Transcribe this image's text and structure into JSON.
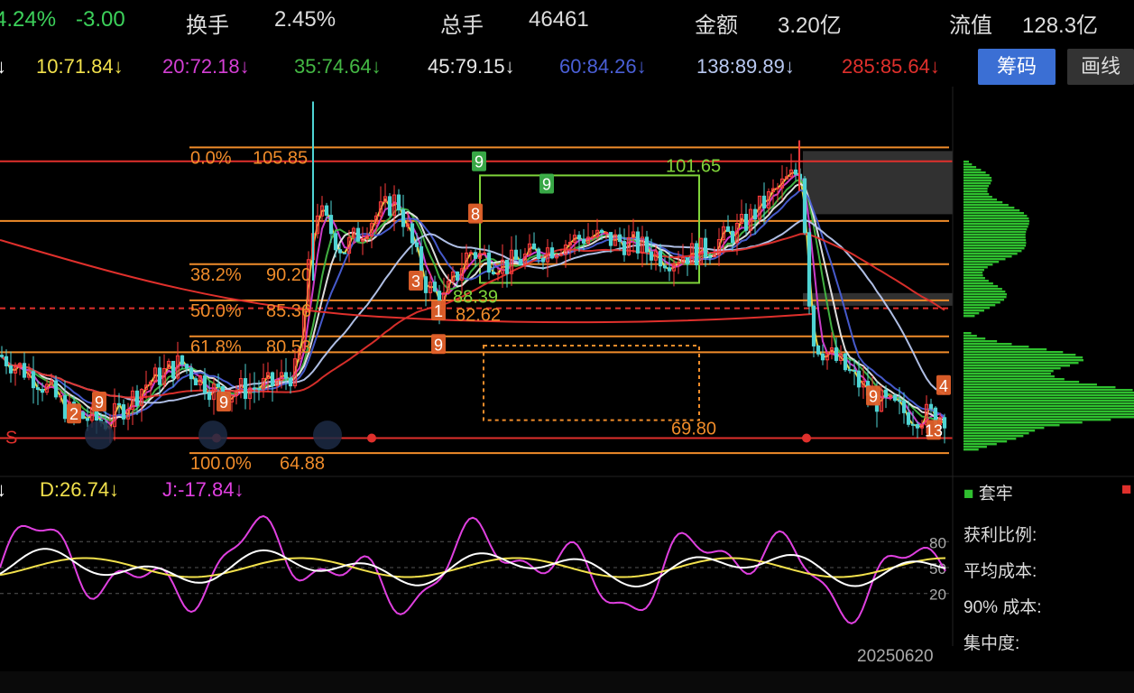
{
  "header": {
    "change_pct": "4.24%",
    "change_amt": "-3.00",
    "turnover_label": "换手",
    "turnover_value": "2.45%",
    "volume_label": "总手",
    "volume_value": "46461",
    "amount_label": "金额",
    "amount_value": "3.20亿",
    "mktcap_label": "流值",
    "mktcap_value": "128.3亿"
  },
  "ma_bar": [
    {
      "text": "↓",
      "color": "#ffffff"
    },
    {
      "text": "10:71.84↓",
      "color": "#f2e14c"
    },
    {
      "text": "20:72.18↓",
      "color": "#d43fd4"
    },
    {
      "text": "35:74.64↓",
      "color": "#44b844"
    },
    {
      "text": "45:79.15↓",
      "color": "#e8e8e8"
    },
    {
      "text": "60:84.26↓",
      "color": "#4a5fd6"
    },
    {
      "text": "138:89.89↓",
      "color": "#b8c8f0"
    },
    {
      "text": "285:85.64↓",
      "color": "#e0302c"
    }
  ],
  "buttons": {
    "chips": "筹码",
    "draw": "画线"
  },
  "fib_labels": [
    {
      "pct": "0.0%",
      "price": "105.85"
    },
    {
      "pct": "38.2%",
      "price": "90.20"
    },
    {
      "pct": "50.0%",
      "price": "85.36"
    },
    {
      "pct": "61.8%",
      "price": "80.53"
    },
    {
      "pct": "100.0%",
      "price": "64.88"
    }
  ],
  "annotations": {
    "high": "101.65",
    "low": "88.39",
    "mid": "82.62",
    "bottom": "69.80",
    "s_marker": "S"
  },
  "td_labels": [
    "9",
    "9",
    "9",
    "9",
    "9",
    "9",
    "8",
    "3",
    "1",
    "2",
    "13",
    "4"
  ],
  "kdj": {
    "k_text": "↓",
    "d_text": "D:26.74↓",
    "j_text": "J:-17.84↓",
    "levels": [
      "80",
      "50",
      "20"
    ]
  },
  "chip_panel": {
    "legend": "套牢",
    "rows": [
      "获利比例:",
      "平均成本:",
      "90% 成本:",
      "集中度:"
    ]
  },
  "date": "20250620",
  "colors": {
    "up": "#ff3b3b",
    "down": "#4fd4d4",
    "fib": "#f08c2a",
    "k": "#ffffff",
    "d": "#f2e14c",
    "j": "#e040e0",
    "chip_green": "#2fbf2f"
  },
  "chart_data": {
    "type": "candlestick",
    "fib_levels": [
      105.85,
      90.2,
      85.36,
      80.53,
      64.88
    ],
    "ylim": [
      62,
      114
    ],
    "series_names": [
      "10",
      "20",
      "35",
      "45",
      "60",
      "138",
      "285"
    ],
    "latest_ma": [
      71.84,
      72.18,
      74.64,
      79.15,
      84.26,
      89.89,
      85.64
    ],
    "kdj_latest": {
      "D": 26.74,
      "J": -17.84
    }
  }
}
